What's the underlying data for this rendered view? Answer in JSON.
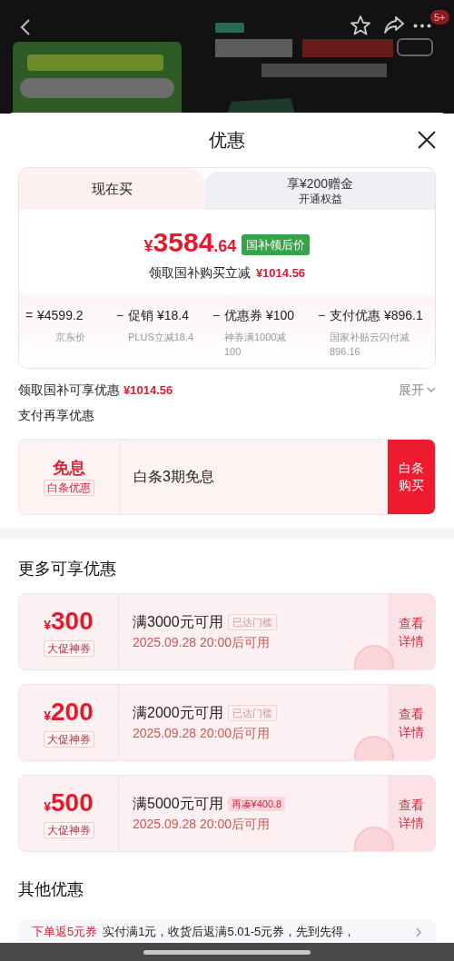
{
  "top_bar": {
    "badge": "5+"
  },
  "sheet": {
    "title": "优惠"
  },
  "tabs": [
    {
      "label": "现在买",
      "selected": true
    },
    {
      "label": "享¥200赠金",
      "sublabel": "开通权益",
      "selected": false
    }
  ],
  "price": {
    "currency": "¥",
    "integer": "3584",
    "decimal": ".64",
    "tag": "国补领后价",
    "note": "领取国补购买立减",
    "note_amount": "¥1014.56"
  },
  "breakdown": [
    {
      "operator": "=",
      "value": "¥4599.2",
      "detail": "京东价"
    },
    {
      "operator": "−",
      "value": "促销 ¥18.4",
      "detail": "PLUS立减18.4"
    },
    {
      "operator": "−",
      "value": "优惠券 ¥100",
      "detail": "神券满1000减100"
    },
    {
      "operator": "−",
      "value": "支付优惠 ¥896.1",
      "detail": "国家补贴云闪付减896.16"
    }
  ],
  "subsidy": {
    "label": "领取国补可享优惠",
    "amount": "¥1014.56",
    "toggle": "展开"
  },
  "payment": {
    "heading": "支付再享优惠",
    "badge_title": "免息",
    "badge_tag": "白条优惠",
    "text": "白条3期免息",
    "button": "白条购买"
  },
  "more": {
    "heading": "更多可享优惠",
    "coupons": [
      {
        "currency": "¥",
        "amount": "300",
        "tag": "大促神券",
        "condition": "满3000元可用",
        "status": "已达门槛",
        "kind": "reached",
        "time": "2025.09.28 20:00后可用",
        "action": "查看详情"
      },
      {
        "currency": "¥",
        "amount": "200",
        "tag": "大促神券",
        "condition": "满2000元可用",
        "status": "已达门槛",
        "kind": "reached",
        "time": "2025.09.28 20:00后可用",
        "action": "查看详情"
      },
      {
        "currency": "¥",
        "amount": "500",
        "tag": "大促神券",
        "condition": "满5000元可用",
        "status": "再凑¥400.8",
        "kind": "short",
        "time": "2025.09.28 20:00后可用",
        "action": "查看详情"
      }
    ]
  },
  "other": {
    "heading": "其他优惠",
    "items": [
      {
        "tag": "下单返5元券",
        "text": "实付满1元，收货后返满5.01-5元券，先到先得，"
      }
    ]
  }
}
